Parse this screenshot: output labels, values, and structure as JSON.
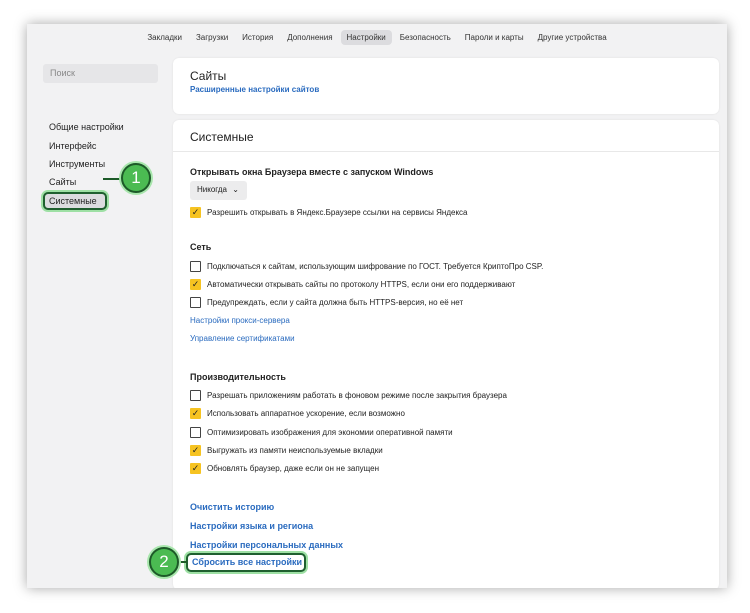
{
  "topnav": [
    "Закладки",
    "Загрузки",
    "История",
    "Дополнения",
    "Настройки",
    "Безопасность",
    "Пароли и карты",
    "Другие устройства"
  ],
  "sidebar": {
    "search_placeholder": "Поиск",
    "items": [
      "Общие настройки",
      "Интерфейс",
      "Инструменты",
      "Сайты",
      "Системные"
    ]
  },
  "sites_card": {
    "title": "Сайты",
    "advanced_link": "Расширенные настройки сайтов"
  },
  "system_card": {
    "title": "Системные",
    "startup": {
      "title": "Открывать окна Браузера вместе с запуском Windows",
      "dropdown_value": "Никогда",
      "dropdown_caret": "⌄",
      "allow_yandex_links": "Разрешить открывать в Яндекс.Браузере ссылки на сервисы Яндекса"
    },
    "network": {
      "title": "Сеть",
      "options": [
        {
          "label": "Подключаться к сайтам, использующим шифрование по ГОСТ. Требуется КриптоПро CSP.",
          "checked": false
        },
        {
          "label": "Автоматически открывать сайты по протоколу HTTPS, если они его поддерживают",
          "checked": true
        },
        {
          "label": "Предупреждать, если у сайта должна быть HTTPS-версия, но её нет",
          "checked": false
        }
      ],
      "proxy_link": "Настройки прокси-сервера",
      "certs_link": "Управление сертификатами"
    },
    "performance": {
      "title": "Производительность",
      "options": [
        {
          "label": "Разрешать приложениям работать в фоновом режиме после закрытия браузера",
          "checked": false
        },
        {
          "label": "Использовать аппаратное ускорение, если возможно",
          "checked": true
        },
        {
          "label": "Оптимизировать изображения для экономии оперативной памяти",
          "checked": false
        },
        {
          "label": "Выгружать из памяти неиспользуемые вкладки",
          "checked": true
        },
        {
          "label": "Обновлять браузер, даже если он не запущен",
          "checked": true
        }
      ]
    },
    "bottom_links": {
      "clear_history": "Очистить историю",
      "language_region": "Настройки языка и региона",
      "personal_data": "Настройки персональных данных",
      "reset_all": "Сбросить все настройки"
    }
  },
  "callouts": {
    "one": "1",
    "two": "2"
  },
  "check_glyph": "✓",
  "colors": {
    "accent_link": "#2a6bbf",
    "checkbox_on": "#f6c321",
    "callout_green": "#4bbb52"
  }
}
